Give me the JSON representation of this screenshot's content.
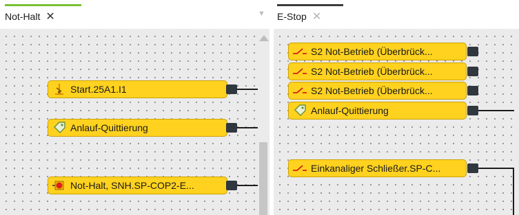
{
  "left_pane": {
    "tab_label": "Not-Halt",
    "tab_close": "✕",
    "pin_glyph": "▼",
    "active_color": "#78c032",
    "blocks": [
      {
        "label": "Start.25A1.I1",
        "icon": "switch-start-icon"
      },
      {
        "label": "Anlauf-Quittierung",
        "icon": "tag-icon"
      },
      {
        "label": "Not-Halt, SNH.SP-COP2-E...",
        "icon": "emergency-stop-icon"
      }
    ]
  },
  "right_pane": {
    "tab_label": "E-Stop",
    "tab_close": "✕",
    "active_color": "#3a3a3a",
    "blocks": [
      {
        "label": "S2 Not-Betrieb (Überbrück...",
        "icon": "contact-icon"
      },
      {
        "label": "S2 Not-Betrieb (Überbrück...",
        "icon": "contact-icon"
      },
      {
        "label": "S2 Not-Betrieb (Überbrück...",
        "icon": "contact-icon"
      },
      {
        "label": "Anlauf-Quittierung",
        "icon": "tag-icon"
      },
      {
        "label": "Einkanaliger Schließer.SP-C...",
        "icon": "contact-icon"
      }
    ]
  },
  "colors": {
    "block_fill": "#ffd21f",
    "block_border": "#cca000",
    "port": "#30373f",
    "canvas": "#ebebeb"
  }
}
